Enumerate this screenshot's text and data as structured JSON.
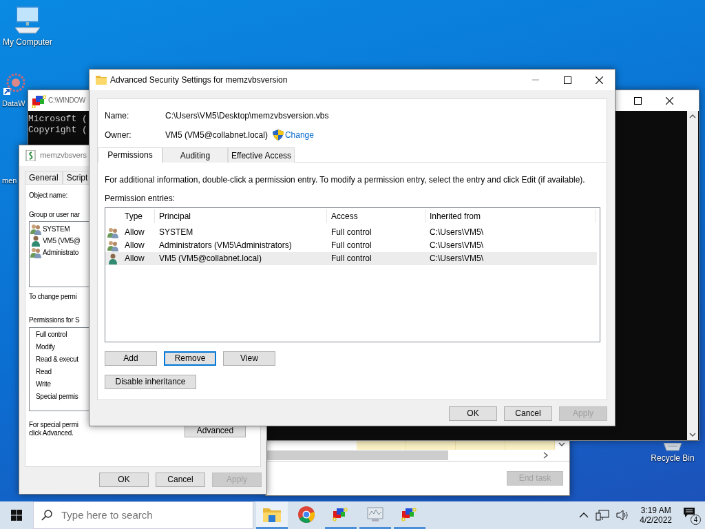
{
  "desktop_icons": [
    {
      "label": "My Computer",
      "kind": "computer"
    },
    {
      "label": "DataW",
      "kind": "app"
    },
    {
      "label": "men",
      "kind": "file"
    },
    {
      "label": "Recycle Bin",
      "kind": "recycle"
    }
  ],
  "console_window": {
    "title": "C:\\WINDOW",
    "lines": [
      "Microsoft (",
      "Copyright ("
    ]
  },
  "task_manager": {
    "end_task_button": {
      "label": "End task",
      "disabled": true
    }
  },
  "properties_window": {
    "title": "memzvbsvers",
    "tabs": [
      {
        "label": "General",
        "selected": false
      },
      {
        "label": "Script",
        "selected": false
      }
    ],
    "object_name_label": "Object name:",
    "group_label": "Group or user nar",
    "principals": [
      {
        "name": "SYSTEM",
        "kind": "group"
      },
      {
        "name": "VM5 (VM5@",
        "kind": "user"
      },
      {
        "name": "Administrato",
        "kind": "group"
      }
    ],
    "change_hint": "To change permi",
    "permissions_label": "Permissions for S",
    "permissions": [
      "Full control",
      "Modify",
      "Read & execut",
      "Read",
      "Write",
      "Special permis"
    ],
    "advanced_hint": [
      "For special permi",
      "click Advanced."
    ],
    "advanced_button": "Advanced",
    "buttons": [
      {
        "label": "OK",
        "disabled": false
      },
      {
        "label": "Cancel",
        "disabled": false
      },
      {
        "label": "Apply",
        "disabled": true
      }
    ]
  },
  "advanced_dialog": {
    "title": "Advanced Security Settings for memzvbsversion",
    "name_label": "Name:",
    "name_value": "C:\\Users\\VM5\\Desktop\\memzvbsversion.vbs",
    "owner_label": "Owner:",
    "owner_value": "VM5 (VM5@collabnet.local)",
    "change_link": "Change",
    "tabs": [
      {
        "label": "Permissions",
        "selected": true
      },
      {
        "label": "Auditing",
        "selected": false
      },
      {
        "label": "Effective Access",
        "selected": false
      }
    ],
    "info": "For additional information, double-click a permission entry. To modify a permission entry, select the entry and click Edit (if available).",
    "entries_label": "Permission entries:",
    "columns": [
      "Type",
      "Principal",
      "Access",
      "Inherited from"
    ],
    "rows": [
      {
        "kind": "group",
        "type": "Allow",
        "principal": "SYSTEM",
        "access": "Full control",
        "inherited_from": "C:\\Users\\VM5\\",
        "selected": false
      },
      {
        "kind": "group",
        "type": "Allow",
        "principal": "Administrators (VM5\\Administrators)",
        "access": "Full control",
        "inherited_from": "C:\\Users\\VM5\\",
        "selected": false
      },
      {
        "kind": "user",
        "type": "Allow",
        "principal": "VM5 (VM5@collabnet.local)",
        "access": "Full control",
        "inherited_from": "C:\\Users\\VM5\\",
        "selected": true
      }
    ],
    "entry_buttons": [
      {
        "label": "Add",
        "focused": false
      },
      {
        "label": "Remove",
        "focused": true
      },
      {
        "label": "View",
        "focused": false
      }
    ],
    "inheritance_button": "Disable inheritance",
    "buttons": [
      {
        "label": "OK",
        "disabled": false
      },
      {
        "label": "Cancel",
        "disabled": false
      },
      {
        "label": "Apply",
        "disabled": true
      }
    ]
  },
  "taskbar": {
    "search": {
      "placeholder": "Type here to search"
    },
    "apps": [
      {
        "kind": "explorer",
        "running": true,
        "active": true
      },
      {
        "kind": "chrome",
        "running": false,
        "active": false
      },
      {
        "kind": "cube",
        "running": true,
        "active": false
      },
      {
        "kind": "monitor",
        "running": true,
        "active": false
      },
      {
        "kind": "cube",
        "running": true,
        "active": false
      }
    ],
    "clock": {
      "time": "3:19 AM",
      "date": "4/2/2022"
    },
    "notifications": {
      "count": "4"
    }
  }
}
